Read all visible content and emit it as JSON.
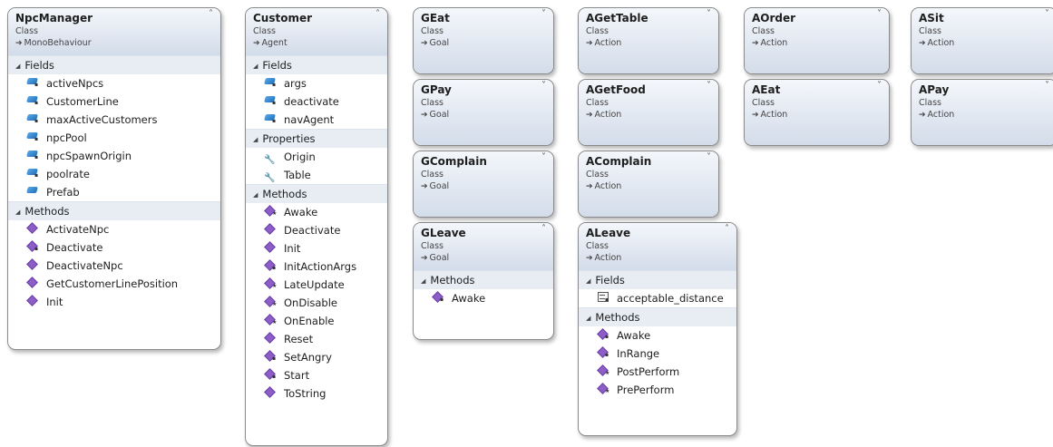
{
  "classes": {
    "npcmanager": {
      "name": "NpcManager",
      "kind": "Class",
      "base": "MonoBehaviour",
      "sections": [
        {
          "title": "Fields",
          "members": [
            {
              "name": "activeNpcs",
              "icon": "field",
              "access": "private"
            },
            {
              "name": "CustomerLine",
              "icon": "field",
              "access": "private"
            },
            {
              "name": "maxActiveCustomers",
              "icon": "field",
              "access": "private"
            },
            {
              "name": "npcPool",
              "icon": "field",
              "access": "private"
            },
            {
              "name": "npcSpawnOrigin",
              "icon": "field",
              "access": "private"
            },
            {
              "name": "poolrate",
              "icon": "field",
              "access": "private"
            },
            {
              "name": "Prefab",
              "icon": "field",
              "access": "public"
            }
          ]
        },
        {
          "title": "Methods",
          "members": [
            {
              "name": "ActivateNpc",
              "icon": "method",
              "access": "public"
            },
            {
              "name": "Deactivate",
              "icon": "method",
              "access": "private"
            },
            {
              "name": "DeactivateNpc",
              "icon": "method",
              "access": "public"
            },
            {
              "name": "GetCustomerLinePosition",
              "icon": "method",
              "access": "public"
            },
            {
              "name": "Init",
              "icon": "method",
              "access": "public"
            }
          ]
        }
      ]
    },
    "customer": {
      "name": "Customer",
      "kind": "Class",
      "base": "Agent",
      "sections": [
        {
          "title": "Fields",
          "members": [
            {
              "name": "args",
              "icon": "field",
              "access": "private"
            },
            {
              "name": "deactivate",
              "icon": "field",
              "access": "private"
            },
            {
              "name": "navAgent",
              "icon": "field",
              "access": "private"
            }
          ]
        },
        {
          "title": "Properties",
          "members": [
            {
              "name": "Origin",
              "icon": "property",
              "access": "public"
            },
            {
              "name": "Table",
              "icon": "property",
              "access": "public"
            }
          ]
        },
        {
          "title": "Methods",
          "members": [
            {
              "name": "Awake",
              "icon": "method",
              "access": "protected"
            },
            {
              "name": "Deactivate",
              "icon": "method",
              "access": "public"
            },
            {
              "name": "Init",
              "icon": "method",
              "access": "public"
            },
            {
              "name": "InitActionArgs",
              "icon": "method",
              "access": "private"
            },
            {
              "name": "LateUpdate",
              "icon": "method",
              "access": "protected"
            },
            {
              "name": "OnDisable",
              "icon": "method",
              "access": "protected"
            },
            {
              "name": "OnEnable",
              "icon": "method",
              "access": "protected"
            },
            {
              "name": "Reset",
              "icon": "method",
              "access": "public"
            },
            {
              "name": "SetAngry",
              "icon": "method",
              "access": "private"
            },
            {
              "name": "Start",
              "icon": "method",
              "access": "private"
            },
            {
              "name": "ToString",
              "icon": "method",
              "access": "public"
            }
          ]
        }
      ]
    },
    "geat": {
      "name": "GEat",
      "kind": "Class",
      "base": "Goal"
    },
    "gpay": {
      "name": "GPay",
      "kind": "Class",
      "base": "Goal"
    },
    "gcomplain": {
      "name": "GComplain",
      "kind": "Class",
      "base": "Goal"
    },
    "gleave": {
      "name": "GLeave",
      "kind": "Class",
      "base": "Goal",
      "sections": [
        {
          "title": "Methods",
          "members": [
            {
              "name": "Awake",
              "icon": "method",
              "access": "private"
            }
          ]
        }
      ]
    },
    "agettable": {
      "name": "AGetTable",
      "kind": "Class",
      "base": "Action"
    },
    "agetfood": {
      "name": "AGetFood",
      "kind": "Class",
      "base": "Action"
    },
    "acomplain": {
      "name": "AComplain",
      "kind": "Class",
      "base": "Action"
    },
    "aleave": {
      "name": "ALeave",
      "kind": "Class",
      "base": "Action",
      "sections": [
        {
          "title": "Fields",
          "members": [
            {
              "name": "acceptable_distance",
              "icon": "constant",
              "access": "private"
            }
          ]
        },
        {
          "title": "Methods",
          "members": [
            {
              "name": "Awake",
              "icon": "method",
              "access": "private"
            },
            {
              "name": "InRange",
              "icon": "method",
              "access": "private"
            },
            {
              "name": "PostPerform",
              "icon": "method",
              "access": "protected"
            },
            {
              "name": "PrePerform",
              "icon": "method",
              "access": "protected"
            }
          ]
        }
      ]
    },
    "aorder": {
      "name": "AOrder",
      "kind": "Class",
      "base": "Action"
    },
    "aeat": {
      "name": "AEat",
      "kind": "Class",
      "base": "Action"
    },
    "asit": {
      "name": "ASit",
      "kind": "Class",
      "base": "Action"
    },
    "apay": {
      "name": "APay",
      "kind": "Class",
      "base": "Action"
    }
  },
  "glyphs": {
    "inherit": "➔",
    "collapse": "˄",
    "expand": "˅",
    "section_toggle": "◢",
    "private": "🔒",
    "protected": "★"
  },
  "colors": {
    "header_top": "#f4f7fb",
    "header_bottom": "#d3dcea",
    "section": "#e8edf4",
    "border": "#8a8a8a"
  }
}
